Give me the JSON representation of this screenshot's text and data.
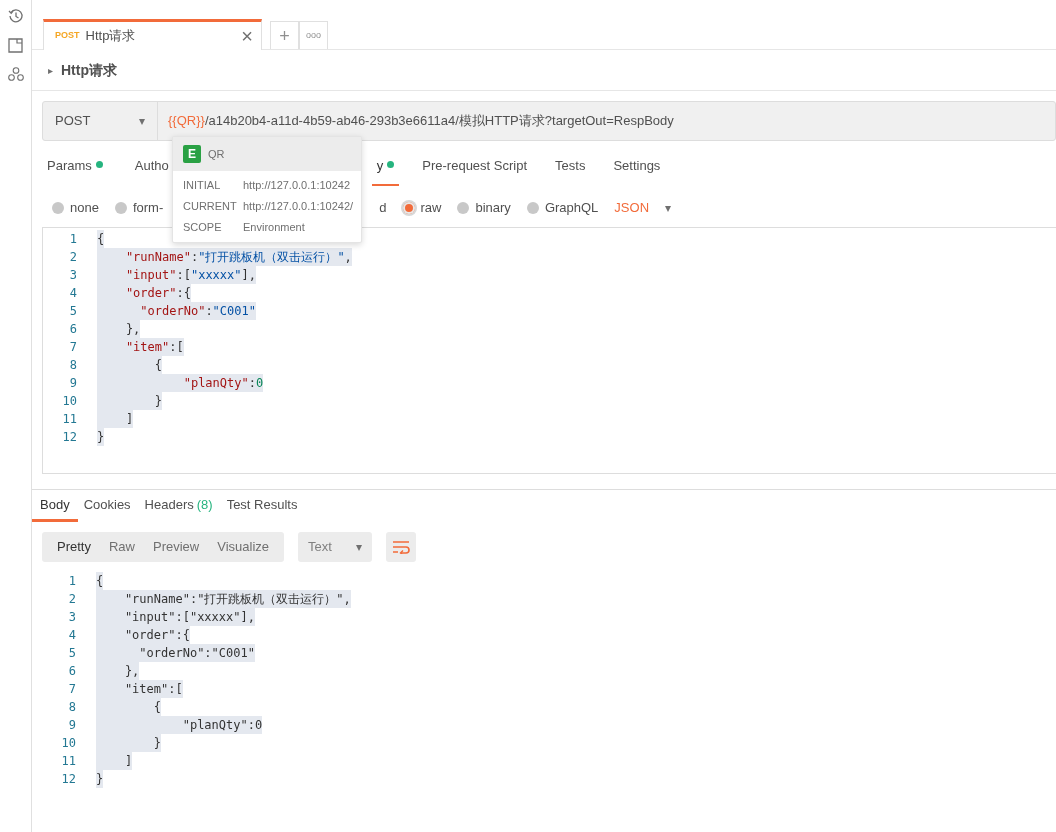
{
  "request_tabs": [
    {
      "method": "POST",
      "title": "Http请求",
      "selected": true,
      "close": "×"
    }
  ],
  "tab_actions": [
    "+",
    "ooo"
  ],
  "request_title": {
    "toggle": "▸",
    "text": "Http请求"
  },
  "url_bar": {
    "method": "POST",
    "caret": "▾",
    "variable": "{{QR}}",
    "path": "/a14b20b4-a11d-4b59-ab46-293b3e6611a4/模拟HTTP请求?targetOut=RespBody"
  },
  "option_tabs": [
    {
      "label": "Params",
      "dot": true,
      "selected": false
    },
    {
      "label": "Autho",
      "dot": false,
      "selected": false
    },
    {
      "label": "y",
      "dot": true,
      "selected": true
    },
    {
      "label": "Pre-request Script",
      "dot": false,
      "selected": false
    },
    {
      "label": "Tests",
      "dot": false,
      "selected": false
    },
    {
      "label": "Settings",
      "dot": false,
      "selected": false
    }
  ],
  "body_types": [
    {
      "kind": "radio",
      "label": "none",
      "selected": false
    },
    {
      "kind": "radio",
      "label": "form-",
      "selected": false
    },
    {
      "kind": "label",
      "label": "d"
    },
    {
      "kind": "radio",
      "label": "raw",
      "selected": true
    },
    {
      "kind": "radio",
      "label": "binary",
      "selected": false
    },
    {
      "kind": "radio",
      "label": "GraphQL",
      "selected": false
    }
  ],
  "body_format": {
    "label": "JSON",
    "caret": "▾"
  },
  "request_body": [
    {
      "number": "1",
      "tokens": [
        {
          "kind": "punct",
          "text": "{"
        }
      ]
    },
    {
      "number": "2",
      "tokens": [
        {
          "kind": "key",
          "text": "    \"runName\""
        },
        {
          "kind": "punct",
          "text": ":"
        },
        {
          "kind": "string",
          "text": "\"打开跳板机（双击运行）\""
        },
        {
          "kind": "punct",
          "text": ","
        }
      ]
    },
    {
      "number": "3",
      "tokens": [
        {
          "kind": "key",
          "text": "    \"input\""
        },
        {
          "kind": "punct",
          "text": ":["
        },
        {
          "kind": "string",
          "text": "\"xxxxx\""
        },
        {
          "kind": "punct",
          "text": "],"
        }
      ]
    },
    {
      "number": "4",
      "tokens": [
        {
          "kind": "key",
          "text": "    \"order\""
        },
        {
          "kind": "punct",
          "text": ":{"
        }
      ]
    },
    {
      "number": "5",
      "tokens": [
        {
          "kind": "key",
          "text": "      \"orderNo\""
        },
        {
          "kind": "punct",
          "text": ":"
        },
        {
          "kind": "string",
          "text": "\"C001\""
        }
      ]
    },
    {
      "number": "6",
      "tokens": [
        {
          "kind": "punct",
          "text": "    },"
        }
      ]
    },
    {
      "number": "7",
      "tokens": [
        {
          "kind": "key",
          "text": "    \"item\""
        },
        {
          "kind": "punct",
          "text": ":["
        }
      ]
    },
    {
      "number": "8",
      "tokens": [
        {
          "kind": "punct",
          "text": "        {"
        }
      ]
    },
    {
      "number": "9",
      "tokens": [
        {
          "kind": "key",
          "text": "            \"planQty\""
        },
        {
          "kind": "punct",
          "text": ":"
        },
        {
          "kind": "number",
          "text": "0"
        }
      ]
    },
    {
      "number": "10",
      "tokens": [
        {
          "kind": "punct",
          "text": "        }"
        }
      ]
    },
    {
      "number": "11",
      "tokens": [
        {
          "kind": "punct",
          "text": "    ]"
        }
      ]
    },
    {
      "number": "12",
      "tokens": [
        {
          "kind": "punct",
          "text": "}"
        }
      ]
    }
  ],
  "variable_popover": {
    "badge": "E",
    "name": "QR",
    "rows": [
      {
        "label": "INITIAL",
        "value": "http://127.0.0.1:10242"
      },
      {
        "label": "CURRENT",
        "value": "http://127.0.0.1:10242/"
      },
      {
        "label": "SCOPE",
        "value": "Environment"
      }
    ]
  },
  "response_tabs": [
    {
      "label": "Body",
      "selected": true
    },
    {
      "label": "Cookies",
      "selected": false
    },
    {
      "label": "Headers",
      "count": "(8)",
      "selected": false
    },
    {
      "label": "Test Results",
      "selected": false
    }
  ],
  "view_modes": [
    {
      "label": "Pretty",
      "selected": true
    },
    {
      "label": "Raw",
      "selected": false
    },
    {
      "label": "Preview",
      "selected": false
    },
    {
      "label": "Visualize",
      "selected": false
    }
  ],
  "response_format": {
    "label": "Text",
    "caret": "▾"
  },
  "response_body": [
    {
      "number": "1",
      "text": "{"
    },
    {
      "number": "2",
      "text": "    \"runName\":\"打开跳板机（双击运行）\","
    },
    {
      "number": "3",
      "text": "    \"input\":[\"xxxxx\"],"
    },
    {
      "number": "4",
      "text": "    \"order\":{"
    },
    {
      "number": "5",
      "text": "      \"orderNo\":\"C001\""
    },
    {
      "number": "6",
      "text": "    },"
    },
    {
      "number": "7",
      "text": "    \"item\":["
    },
    {
      "number": "8",
      "text": "        {"
    },
    {
      "number": "9",
      "text": "            \"planQty\":0"
    },
    {
      "number": "10",
      "text": "        }"
    },
    {
      "number": "11",
      "text": "    ]"
    },
    {
      "number": "12",
      "text": "}"
    }
  ]
}
